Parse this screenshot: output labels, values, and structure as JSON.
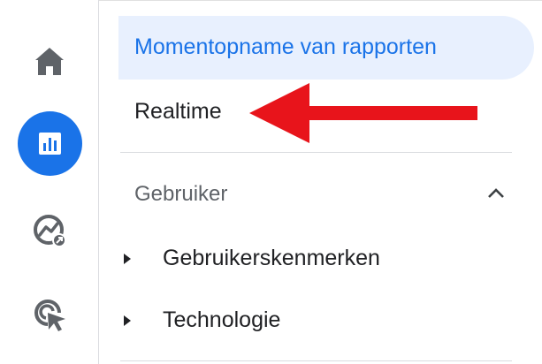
{
  "colors": {
    "accent": "#1a73e8",
    "active_bg": "#e8f0fe",
    "icon_gray": "#5f6368",
    "annotation_red": "#e8141b"
  },
  "rail": {
    "items": [
      {
        "icon": "home-icon"
      },
      {
        "icon": "reports-icon",
        "selected": true
      },
      {
        "icon": "explore-icon"
      },
      {
        "icon": "advertising-icon"
      }
    ]
  },
  "nav": {
    "snapshot_label": "Momentopname van rapporten",
    "realtime_label": "Realtime",
    "section": {
      "label": "Gebruiker",
      "expanded": true,
      "items": [
        {
          "label": "Gebruikerskenmerken"
        },
        {
          "label": "Technologie"
        }
      ]
    }
  },
  "annotation": {
    "type": "arrow",
    "points_to": "Realtime"
  }
}
